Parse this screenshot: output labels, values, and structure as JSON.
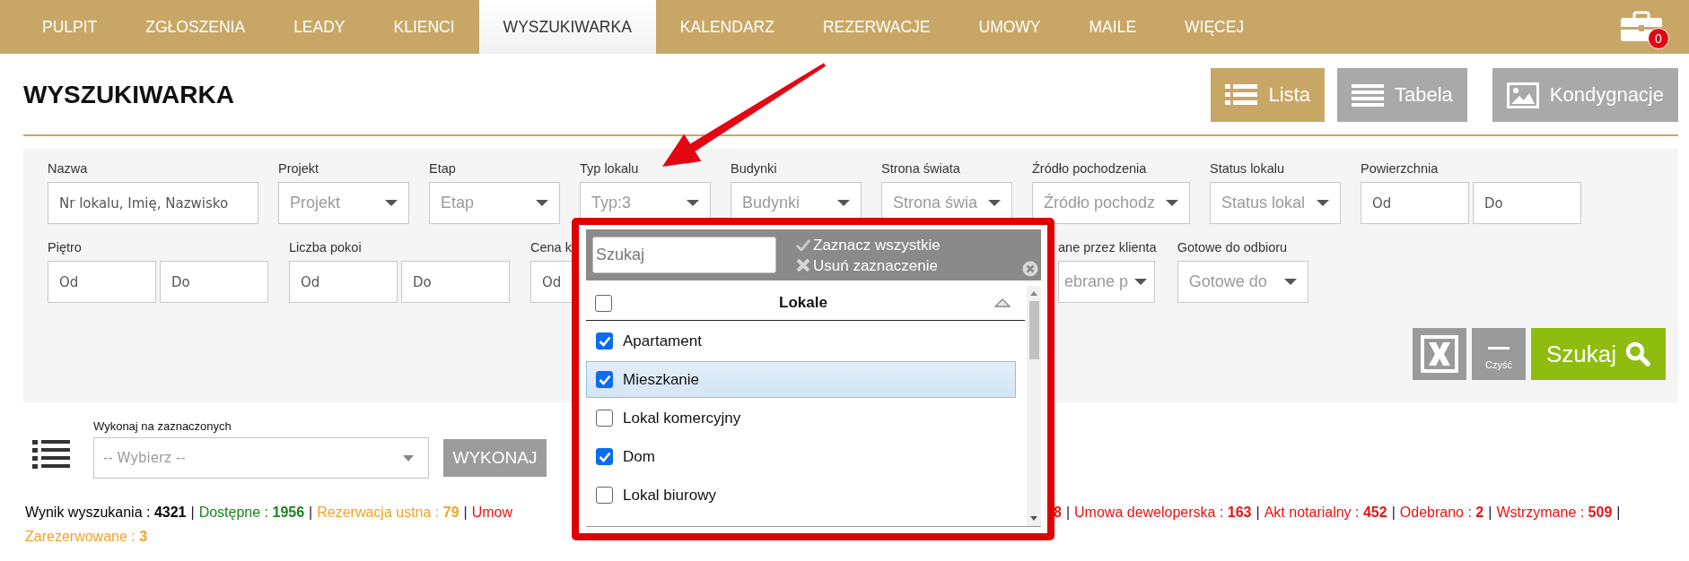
{
  "nav": {
    "items": [
      {
        "label": "PULPIT",
        "selected": false
      },
      {
        "label": "ZGŁOSZENIA",
        "selected": false
      },
      {
        "label": "LEADY",
        "selected": false
      },
      {
        "label": "KLIENCI",
        "selected": false
      },
      {
        "label": "WYSZUKIWARKA",
        "selected": true
      },
      {
        "label": "KALENDARZ",
        "selected": false
      },
      {
        "label": "REZERWACJE",
        "selected": false
      },
      {
        "label": "UMOWY",
        "selected": false
      },
      {
        "label": "MAILE",
        "selected": false
      },
      {
        "label": "WIĘCEJ",
        "selected": false
      }
    ],
    "cart_badge": "0"
  },
  "page_title": "WYSZUKIWARKA",
  "view_buttons": [
    {
      "label": "Lista",
      "kind": "list",
      "selected": true
    },
    {
      "label": "Tabela",
      "kind": "table",
      "selected": false
    },
    {
      "label": "Kondygnacje",
      "kind": "image",
      "selected": false
    }
  ],
  "filters": {
    "row_1": [
      {
        "label": "Nazwa",
        "kind": "text",
        "placeholder": "Nr lokalu, Imię, Nazwisko"
      },
      {
        "label": "Projekt",
        "kind": "select",
        "placeholder": "Projekt"
      },
      {
        "label": "Etap",
        "kind": "select",
        "placeholder": "Etap"
      },
      {
        "label": "Typ lokalu",
        "kind": "select",
        "placeholder": "Typ:3"
      },
      {
        "label": "Budynki",
        "kind": "select",
        "placeholder": "Budynki"
      },
      {
        "label": "Strona świata",
        "kind": "select",
        "placeholder": "Strona świa"
      },
      {
        "label": "Źródło pochodzenia",
        "kind": "select",
        "placeholder": "Źródło pochodz"
      },
      {
        "label": "Status lokalu",
        "kind": "select",
        "placeholder": "Status lokal"
      },
      {
        "label": "Powierzchnia",
        "kind": "range",
        "from_placeholder": "Od",
        "to_placeholder": "Do"
      }
    ],
    "row_2": [
      {
        "label": "Piętro",
        "kind": "range",
        "from_placeholder": "Od",
        "to_placeholder": "Do"
      },
      {
        "label": "Liczba pokoi",
        "kind": "range",
        "from_placeholder": "Od",
        "to_placeholder": "Do"
      },
      {
        "label": "Cena k",
        "kind": "text",
        "placeholder": "Od"
      },
      {
        "label": "ane przez klienta",
        "kind": "select",
        "placeholder": "ebrane p"
      },
      {
        "label": "Gotowe do odbioru",
        "kind": "select",
        "placeholder": "Gotowe do"
      }
    ],
    "clear_label": "Czyść",
    "search_label": "Szukaj"
  },
  "bulk_action": {
    "label": "Wykonaj na zaznaczonych",
    "placeholder": "-- Wybierz --",
    "button": "WYKONAJ"
  },
  "results": {
    "line_1": [
      {
        "kind": "stat",
        "text": "Wynik wyszukania : **4321**",
        "color": "#000000"
      },
      {
        "kind": "separator",
        "text": "|"
      },
      {
        "kind": "stat",
        "text": "Dostępne : **1956**",
        "color": "#1a841a"
      },
      {
        "kind": "separator",
        "text": "|"
      },
      {
        "kind": "stat",
        "text": "Rezerwacja ustna : **79**",
        "color": "#f7a025"
      },
      {
        "kind": "separator",
        "text": "|"
      },
      {
        "kind": "stat",
        "text": "Umow",
        "color": "#ee1111"
      }
    ],
    "line_1_after_dropdown": [
      {
        "kind": "stat",
        "text": "**8**",
        "color": "#ee1111"
      },
      {
        "kind": "separator",
        "text": "|"
      },
      {
        "kind": "stat",
        "text": "Umowa deweloperska : **163**",
        "color": "#ee1111"
      },
      {
        "kind": "separator",
        "text": "|"
      },
      {
        "kind": "stat",
        "text": "Akt notarialny : **452**",
        "color": "#ee1111"
      },
      {
        "kind": "separator",
        "text": "|"
      },
      {
        "kind": "stat",
        "text": "Odebrano : **2**",
        "color": "#ee1111"
      },
      {
        "kind": "separator",
        "text": "|"
      },
      {
        "kind": "stat",
        "text": "Wstrzymane : **509**",
        "color": "#ee1111"
      },
      {
        "kind": "separator",
        "text": "|"
      }
    ],
    "line_2": [
      {
        "kind": "stat",
        "text": "Zarezerwowane : **3**",
        "color": "#f7a025"
      }
    ]
  },
  "type_dropdown": {
    "search_placeholder": "Szukaj",
    "select_all": "Zaznacz wszystkie",
    "clear_selection": "Usuń zaznaczenie",
    "header": {
      "label": "Lokale",
      "checked": false
    },
    "options": [
      {
        "label": "Apartament",
        "checked": true,
        "highlighted": false
      },
      {
        "label": "Mieszkanie",
        "checked": true,
        "highlighted": true
      },
      {
        "label": "Lokal komercyjny",
        "checked": false,
        "highlighted": false
      },
      {
        "label": "Dom",
        "checked": true,
        "highlighted": false
      },
      {
        "label": "Lokal biurowy",
        "checked": false,
        "highlighted": false
      }
    ]
  }
}
